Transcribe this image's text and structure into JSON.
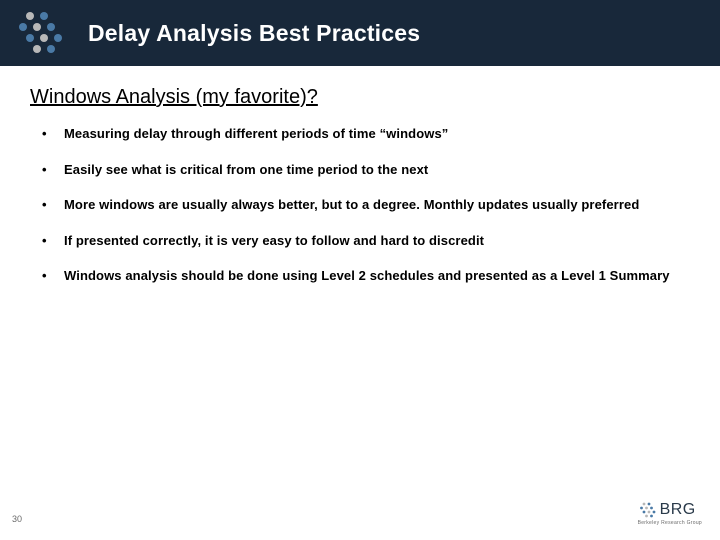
{
  "header": {
    "title": "Delay Analysis Best Practices"
  },
  "subhead": "Windows Analysis (my favorite)?",
  "bullets": [
    "Measuring delay through different periods of time “windows”",
    "Easily see what is critical from one time period to the next",
    "More windows are usually always better, but to a degree. Monthly updates usually preferred",
    "If presented correctly, it is very easy to follow and hard to discredit",
    "Windows analysis should be done using Level 2 schedules and presented as a Level 1 Summary"
  ],
  "page_number": "30",
  "footer_logo": {
    "brand": "BRG",
    "tagline": "Berkeley Research Group"
  },
  "colors": {
    "header_bg": "#18283a",
    "dot_blue": "#4a7aa6",
    "dot_grey": "#b8b8b8"
  }
}
